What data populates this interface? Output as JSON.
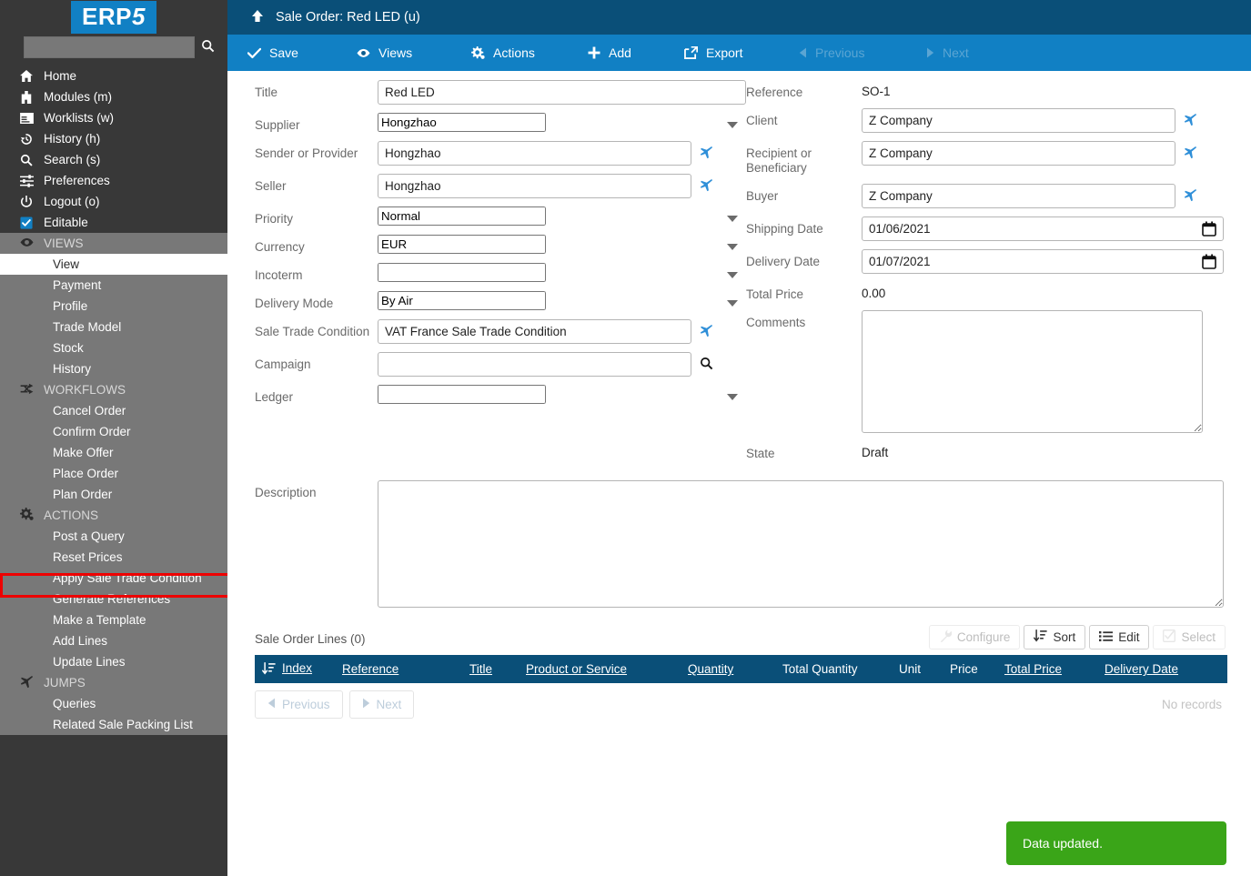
{
  "brand": {
    "logo_main": "ERP",
    "logo_accent": "5"
  },
  "sidebar": {
    "search_placeholder": "",
    "search_value": "",
    "nav": [
      {
        "icon": "home-icon",
        "label": "Home"
      },
      {
        "icon": "modules-icon",
        "label": "Modules (m)"
      },
      {
        "icon": "worklists-icon",
        "label": "Worklists (w)"
      },
      {
        "icon": "history-icon",
        "label": "History (h)"
      },
      {
        "icon": "search-icon",
        "label": "Search (s)"
      },
      {
        "icon": "preferences-icon",
        "label": "Preferences"
      },
      {
        "icon": "logout-icon",
        "label": "Logout (o)"
      },
      {
        "icon": "checkbox-checked-icon",
        "label": "Editable"
      }
    ],
    "groups": [
      {
        "icon": "eye-icon",
        "title": "VIEWS",
        "items": [
          {
            "label": "View",
            "active": true
          },
          {
            "label": "Payment",
            "active": false
          },
          {
            "label": "Profile",
            "active": false
          },
          {
            "label": "Trade Model",
            "active": false
          },
          {
            "label": "Stock",
            "active": false
          },
          {
            "label": "History",
            "active": false
          }
        ]
      },
      {
        "icon": "workflows-icon",
        "title": "WORKFLOWS",
        "items": [
          {
            "label": "Cancel Order",
            "active": false
          },
          {
            "label": "Confirm Order",
            "active": false
          },
          {
            "label": "Make Offer",
            "active": false
          },
          {
            "label": "Place Order",
            "active": false
          },
          {
            "label": "Plan Order",
            "active": false
          }
        ]
      },
      {
        "icon": "actions-icon",
        "title": "ACTIONS",
        "items": [
          {
            "label": "Post a Query",
            "active": false
          },
          {
            "label": "Reset Prices",
            "active": false
          },
          {
            "label": "Apply Sale Trade Condition",
            "active": false,
            "highlighted": true
          },
          {
            "label": "Generate References",
            "active": false
          },
          {
            "label": "Make a Template",
            "active": false
          },
          {
            "label": "Add Lines",
            "active": false
          },
          {
            "label": "Update Lines",
            "active": false
          }
        ]
      },
      {
        "icon": "jumps-icon",
        "title": "JUMPS",
        "items": [
          {
            "label": "Queries",
            "active": false
          },
          {
            "label": "Related Sale Packing List",
            "active": false
          }
        ]
      }
    ]
  },
  "header": {
    "up_icon": "arrow-up-icon",
    "title": "Sale Order: Red LED (u)"
  },
  "toolbar": {
    "buttons": [
      {
        "icon": "check-icon",
        "label": "Save",
        "disabled": false
      },
      {
        "icon": "eye-icon",
        "label": "Views",
        "disabled": false
      },
      {
        "icon": "actions-icon",
        "label": "Actions",
        "disabled": false
      },
      {
        "icon": "plus-icon",
        "label": "Add",
        "disabled": false
      },
      {
        "icon": "export-icon",
        "label": "Export",
        "disabled": false
      },
      {
        "icon": "prev-icon",
        "label": "Previous",
        "disabled": true
      },
      {
        "icon": "next-icon",
        "label": "Next",
        "disabled": true
      }
    ]
  },
  "form": {
    "left": {
      "title": {
        "label": "Title",
        "value": "Red LED"
      },
      "supplier": {
        "label": "Supplier",
        "value": "Hongzhao"
      },
      "sender": {
        "label": "Sender or Provider",
        "value": "Hongzhao"
      },
      "seller": {
        "label": "Seller",
        "value": "Hongzhao"
      },
      "priority": {
        "label": "Priority",
        "value": "Normal"
      },
      "currency": {
        "label": "Currency",
        "value": "EUR"
      },
      "incoterm": {
        "label": "Incoterm",
        "value": ""
      },
      "delivery_mode": {
        "label": "Delivery Mode",
        "value": "By Air"
      },
      "stc": {
        "label": "Sale Trade Condition",
        "value": "VAT France Sale Trade Condition"
      },
      "campaign": {
        "label": "Campaign",
        "value": ""
      },
      "ledger": {
        "label": "Ledger",
        "value": ""
      }
    },
    "right": {
      "reference": {
        "label": "Reference",
        "value": "SO-1"
      },
      "client": {
        "label": "Client",
        "value": "Z Company"
      },
      "recipient": {
        "label": "Recipient or Beneficiary",
        "value": "Z Company"
      },
      "buyer": {
        "label": "Buyer",
        "value": "Z Company"
      },
      "shipping_date": {
        "label": "Shipping Date",
        "value": "01/06/2021"
      },
      "delivery_date": {
        "label": "Delivery Date",
        "value": "01/07/2021"
      },
      "total_price": {
        "label": "Total Price",
        "value": "0.00"
      },
      "comments": {
        "label": "Comments",
        "value": ""
      },
      "state": {
        "label": "State",
        "value": "Draft"
      }
    },
    "description": {
      "label": "Description",
      "value": ""
    }
  },
  "lines": {
    "title": "Sale Order Lines (0)",
    "tools": [
      {
        "icon": "wrench-icon",
        "label": "Configure",
        "disabled": true
      },
      {
        "icon": "sort-icon",
        "label": "Sort",
        "disabled": false
      },
      {
        "icon": "list-icon",
        "label": "Edit",
        "disabled": false
      },
      {
        "icon": "checkbox-icon",
        "label": "Select",
        "disabled": true
      }
    ],
    "columns": [
      {
        "label": "Index",
        "sortable": true
      },
      {
        "label": "Reference",
        "sortable": true
      },
      {
        "label": "Title",
        "sortable": true
      },
      {
        "label": "Product or Service",
        "sortable": true
      },
      {
        "label": "Quantity",
        "sortable": true
      },
      {
        "label": "Total Quantity",
        "sortable": false
      },
      {
        "label": "Unit",
        "sortable": false
      },
      {
        "label": "Price",
        "sortable": false
      },
      {
        "label": "Total Price",
        "sortable": true
      },
      {
        "label": "Delivery Date",
        "sortable": true
      }
    ],
    "rows": [],
    "empty_text": "No records",
    "pager": [
      {
        "icon": "prev-icon",
        "label": "Previous",
        "disabled": true
      },
      {
        "icon": "next-icon",
        "label": "Next",
        "disabled": true
      }
    ]
  },
  "toast": {
    "message": "Data updated.",
    "color": "#3aa518"
  },
  "colors": {
    "sidebar_bg": "#383838",
    "sidebar_group_bg": "#787878",
    "header_bg": "#0a4f78",
    "toolbar_bg": "#1180c4",
    "accent": "#1180c4",
    "highlight_border": "#ee0000",
    "toast_green": "#3aa518"
  }
}
